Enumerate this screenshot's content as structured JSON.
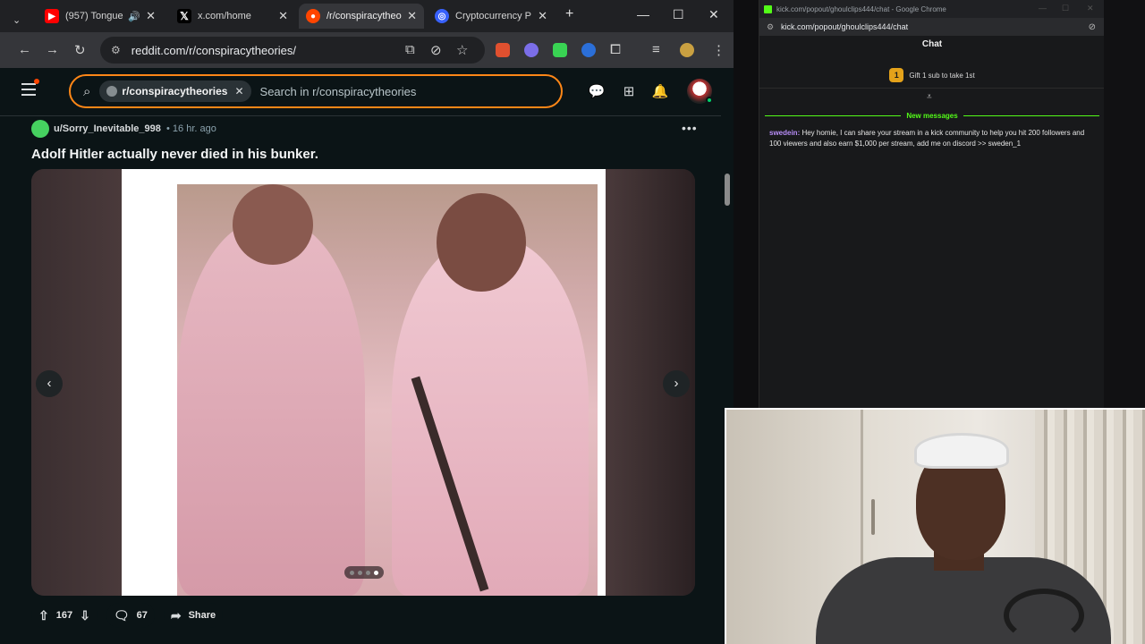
{
  "browser": {
    "tabs": [
      {
        "label": "(957) Tongue",
        "favicon": "youtube-icon",
        "color": "#ff0000"
      },
      {
        "label": "x.com/home",
        "favicon": "x-icon",
        "color": "#000000"
      },
      {
        "label": "/r/conspiracytheo",
        "favicon": "reddit-icon",
        "color": "#ff4500"
      },
      {
        "label": "Cryptocurrency P",
        "favicon": "coinmarket-icon",
        "color": "#3861fb"
      }
    ],
    "url": "reddit.com/r/conspiracytheories/"
  },
  "reddit": {
    "search_chip": "r/conspiracytheories",
    "search_placeholder": "Search in r/conspiracytheories",
    "post": {
      "username": "u/Sorry_Inevitable_998",
      "time": "• 16 hr. ago",
      "title": "Adolf Hitler actually never died in his bunker.",
      "upvotes": "167",
      "comments": "67",
      "share_label": "Share",
      "gallery_index": 4,
      "gallery_count": 4
    }
  },
  "chat": {
    "window_title": "kick.com/popout/ghoulclips444/chat - Google Chrome",
    "url": "kick.com/popout/ghoulclips444/chat",
    "header": "Chat",
    "gift_badge": "1",
    "gift_text": "Gift 1 sub to take 1st",
    "new_messages_label": "New messages",
    "messages": [
      {
        "user": "swedein:",
        "text": " Hey homie, I can share your stream in a kick community to help you hit 200 followers and 100 viewers and also earn $1,000 per stream, add me on discord >> sweden_1"
      }
    ]
  },
  "colors": {
    "reddit_accent": "#ff4500",
    "search_border": "#ff8717",
    "kick_green": "#53fc18"
  }
}
